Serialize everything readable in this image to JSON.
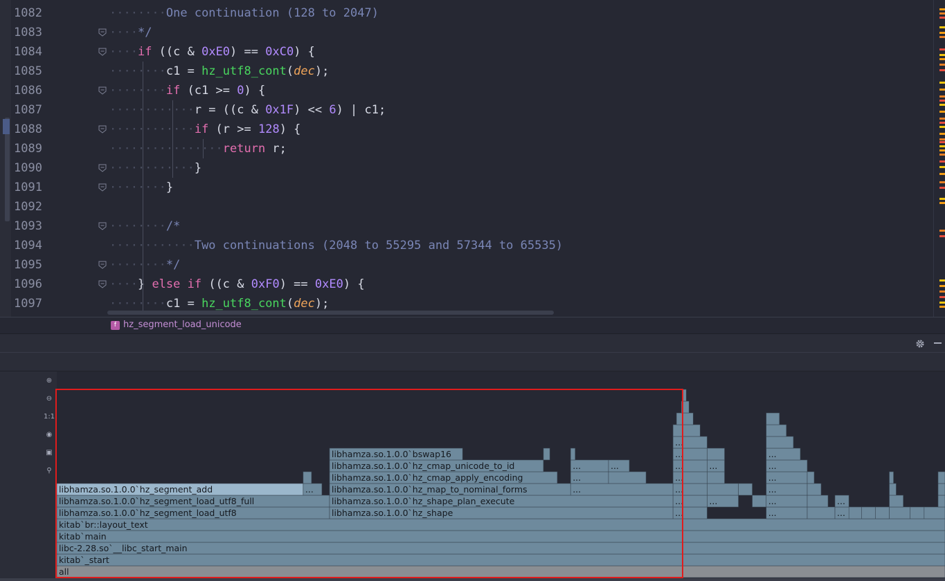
{
  "editor": {
    "lines": [
      {
        "n": "1082",
        "indent": 2,
        "segs": [
          [
            "cm",
            "One continuation (128 to 2047)"
          ]
        ]
      },
      {
        "n": "1083",
        "indent": 1,
        "segs": [
          [
            "cm",
            "*/"
          ]
        ]
      },
      {
        "n": "1084",
        "indent": 1,
        "segs": [
          [
            "kw",
            "if"
          ],
          [
            "op",
            " ((c & "
          ],
          [
            "num",
            "0xE0"
          ],
          [
            "op",
            ") == "
          ],
          [
            "num",
            "0xC0"
          ],
          [
            "op",
            ") {"
          ]
        ]
      },
      {
        "n": "1085",
        "indent": 2,
        "segs": [
          [
            "op",
            "c1 = "
          ],
          [
            "fn",
            "hz_utf8_cont"
          ],
          [
            "op",
            "("
          ],
          [
            "par",
            "dec"
          ],
          [
            "op",
            ");"
          ]
        ]
      },
      {
        "n": "1086",
        "indent": 2,
        "segs": [
          [
            "kw",
            "if"
          ],
          [
            "op",
            " (c1 >= "
          ],
          [
            "num",
            "0"
          ],
          [
            "op",
            ") {"
          ]
        ]
      },
      {
        "n": "1087",
        "indent": 3,
        "segs": [
          [
            "op",
            "r = ((c & "
          ],
          [
            "num",
            "0x1F"
          ],
          [
            "op",
            ") << "
          ],
          [
            "num",
            "6"
          ],
          [
            "op",
            ") | c1;"
          ]
        ]
      },
      {
        "n": "1088",
        "indent": 3,
        "segs": [
          [
            "kw",
            "if"
          ],
          [
            "op",
            " (r >= "
          ],
          [
            "num",
            "128"
          ],
          [
            "op",
            ") {"
          ]
        ]
      },
      {
        "n": "1089",
        "indent": 4,
        "segs": [
          [
            "kw",
            "return"
          ],
          [
            "op",
            " r;"
          ]
        ]
      },
      {
        "n": "1090",
        "indent": 3,
        "segs": [
          [
            "op",
            "}"
          ]
        ]
      },
      {
        "n": "1091",
        "indent": 2,
        "segs": [
          [
            "op",
            "}"
          ]
        ]
      },
      {
        "n": "1092",
        "indent": 0,
        "segs": []
      },
      {
        "n": "1093",
        "indent": 2,
        "segs": [
          [
            "cm",
            "/*"
          ]
        ]
      },
      {
        "n": "1094",
        "indent": 3,
        "segs": [
          [
            "cm",
            "Two continuations (2048 to 55295 and 57344 to 65535)"
          ]
        ]
      },
      {
        "n": "1095",
        "indent": 2,
        "segs": [
          [
            "cm",
            "*/"
          ]
        ]
      },
      {
        "n": "1096",
        "indent": 1,
        "segs": [
          [
            "op",
            "} "
          ],
          [
            "kw",
            "else if"
          ],
          [
            "op",
            " ((c & "
          ],
          [
            "num",
            "0xF0"
          ],
          [
            "op",
            ") == "
          ],
          [
            "num",
            "0xE0"
          ],
          [
            "op",
            ") {"
          ]
        ]
      },
      {
        "n": "1097",
        "indent": 2,
        "segs": [
          [
            "op",
            "c1 = "
          ],
          [
            "fn",
            "hz_utf8_cont"
          ],
          [
            "op",
            "("
          ],
          [
            "par",
            "dec"
          ],
          [
            "op",
            ");"
          ]
        ]
      }
    ],
    "fold_lines": [
      "1083",
      "1084",
      "1086",
      "1088",
      "1090",
      "1091",
      "1093",
      "1095",
      "1096"
    ]
  },
  "breadcrumb": {
    "badge": "f",
    "function": "hz_segment_load_unicode"
  },
  "flame_tools": [
    {
      "name": "zoom-in-icon",
      "glyph": "⊕"
    },
    {
      "name": "zoom-out-icon",
      "glyph": "⊖"
    },
    {
      "name": "actual-size-icon",
      "glyph": "1:1"
    },
    {
      "name": "eye-icon",
      "glyph": "◉"
    },
    {
      "name": "camera-icon",
      "glyph": "▣"
    },
    {
      "name": "search-icon",
      "glyph": "⚲"
    }
  ],
  "flame": {
    "colors": {
      "frame": "#6e8a9d",
      "highlight": "#9bb7cc",
      "root": "#8a8e93",
      "border": "#3a4754"
    },
    "frames": [
      {
        "label": "all",
        "start": 0.0,
        "end": 1.0,
        "depth": 0,
        "kind": "root"
      },
      {
        "label": "kitab`_start",
        "start": 0.0,
        "end": 1.0,
        "depth": 1
      },
      {
        "label": "libc-2.28.so`__libc_start_main",
        "start": 0.0,
        "end": 1.0,
        "depth": 2
      },
      {
        "label": "kitab`main",
        "start": 0.0,
        "end": 1.0,
        "depth": 3
      },
      {
        "label": "kitab`br::layout_text",
        "start": 0.0,
        "end": 1.0,
        "depth": 4
      },
      {
        "label": "libhamza.so.1.0.0`hz_segment_load_utf8",
        "start": 0.0,
        "end": 0.3071,
        "depth": 5
      },
      {
        "label": "libhamza.so.1.0.0`hz_segment_load_utf8_full",
        "start": 0.0,
        "end": 0.3071,
        "depth": 6
      },
      {
        "label": "libhamza.so.1.0.0`hz_segment_add",
        "start": 0.0,
        "end": 0.2774,
        "depth": 7,
        "kind": "highlight"
      },
      {
        "label": "...",
        "start": 0.2774,
        "end": 0.2985,
        "depth": 7
      },
      {
        "label": "",
        "start": 0.2774,
        "end": 0.2868,
        "depth": 8
      },
      {
        "label": "libhamza.so.1.0.0`hz_shape",
        "start": 0.3071,
        "end": 0.6938,
        "depth": 5
      },
      {
        "label": "libhamza.so.1.0.0`hz_shape_plan_execute",
        "start": 0.3071,
        "end": 0.6938,
        "depth": 6
      },
      {
        "label": "libhamza.so.1.0.0`hz_map_to_nominal_forms",
        "start": 0.3071,
        "end": 0.5785,
        "depth": 7
      },
      {
        "label": "...",
        "start": 0.5785,
        "end": 0.6938,
        "depth": 7
      },
      {
        "label": "libhamza.so.1.0.0`hz_cmap_apply_encoding",
        "start": 0.3071,
        "end": 0.5635,
        "depth": 8
      },
      {
        "label": "...",
        "start": 0.5785,
        "end": 0.6212,
        "depth": 8
      },
      {
        "label": "",
        "start": 0.6212,
        "end": 0.6634,
        "depth": 8
      },
      {
        "label": "libhamza.so.1.0.0`hz_cmap_unicode_to_id",
        "start": 0.3071,
        "end": 0.5479,
        "depth": 9
      },
      {
        "label": "...",
        "start": 0.5785,
        "end": 0.6212,
        "depth": 9
      },
      {
        "label": "...",
        "start": 0.6212,
        "end": 0.6446,
        "depth": 9
      },
      {
        "label": "libhamza.so.1.0.0`bswap16",
        "start": 0.3071,
        "end": 0.4569,
        "depth": 10
      },
      {
        "label": "",
        "start": 0.5479,
        "end": 0.5551,
        "depth": 10
      },
      {
        "label": "",
        "start": 0.5785,
        "end": 0.5836,
        "depth": 10
      },
      {
        "label": "...",
        "start": 0.6938,
        "end": 0.7322,
        "depth": 5
      },
      {
        "label": "...",
        "start": 0.6938,
        "end": 0.7322,
        "depth": 6
      },
      {
        "label": "...",
        "start": 0.6938,
        "end": 0.7322,
        "depth": 7
      },
      {
        "label": "...",
        "start": 0.6938,
        "end": 0.7322,
        "depth": 8
      },
      {
        "label": "...",
        "start": 0.6938,
        "end": 0.7322,
        "depth": 9
      },
      {
        "label": "...",
        "start": 0.6938,
        "end": 0.7322,
        "depth": 10
      },
      {
        "label": "...",
        "start": 0.6938,
        "end": 0.7322,
        "depth": 11
      },
      {
        "label": "",
        "start": 0.6938,
        "end": 0.7243,
        "depth": 12
      },
      {
        "label": "",
        "start": 0.6977,
        "end": 0.7165,
        "depth": 13
      },
      {
        "label": "",
        "start": 0.7032,
        "end": 0.7118,
        "depth": 14
      },
      {
        "label": "",
        "start": 0.7048,
        "end": 0.7087,
        "depth": 15
      },
      {
        "label": "...",
        "start": 0.7322,
        "end": 0.7674,
        "depth": 6
      },
      {
        "label": "",
        "start": 0.7322,
        "end": 0.7674,
        "depth": 7
      },
      {
        "label": "",
        "start": 0.7322,
        "end": 0.7518,
        "depth": 8
      },
      {
        "label": "...",
        "start": 0.7322,
        "end": 0.7518,
        "depth": 9
      },
      {
        "label": "",
        "start": 0.7322,
        "end": 0.7518,
        "depth": 10
      },
      {
        "label": "",
        "start": 0.7674,
        "end": 0.783,
        "depth": 7
      },
      {
        "label": "",
        "start": 0.783,
        "end": 0.7987,
        "depth": 6
      },
      {
        "label": "...",
        "start": 0.7987,
        "end": 0.8449,
        "depth": 5
      },
      {
        "label": "...",
        "start": 0.7987,
        "end": 0.8449,
        "depth": 6
      },
      {
        "label": "...",
        "start": 0.7987,
        "end": 0.8449,
        "depth": 7
      },
      {
        "label": "...",
        "start": 0.7987,
        "end": 0.8449,
        "depth": 8
      },
      {
        "label": "...",
        "start": 0.7987,
        "end": 0.8449,
        "depth": 9
      },
      {
        "label": "...",
        "start": 0.7987,
        "end": 0.8371,
        "depth": 10
      },
      {
        "label": "",
        "start": 0.7987,
        "end": 0.8293,
        "depth": 11
      },
      {
        "label": "",
        "start": 0.7987,
        "end": 0.8214,
        "depth": 12
      },
      {
        "label": "",
        "start": 0.7987,
        "end": 0.8136,
        "depth": 13
      },
      {
        "label": "",
        "start": 0.8449,
        "end": 0.8761,
        "depth": 5
      },
      {
        "label": "",
        "start": 0.8449,
        "end": 0.8683,
        "depth": 6
      },
      {
        "label": "",
        "start": 0.8449,
        "end": 0.8605,
        "depth": 7
      },
      {
        "label": "",
        "start": 0.8449,
        "end": 0.8527,
        "depth": 8
      },
      {
        "label": "...",
        "start": 0.8761,
        "end": 0.9373,
        "depth": 5
      },
      {
        "label": "...",
        "start": 0.8761,
        "end": 0.8918,
        "depth": 6
      },
      {
        "label": "",
        "start": 0.8918,
        "end": 0.906,
        "depth": 5
      },
      {
        "label": "",
        "start": 0.906,
        "end": 0.9216,
        "depth": 5
      },
      {
        "label": "",
        "start": 0.9216,
        "end": 0.9373,
        "depth": 5
      },
      {
        "label": "",
        "start": 0.9373,
        "end": 0.9608,
        "depth": 5
      },
      {
        "label": "",
        "start": 0.9608,
        "end": 0.9765,
        "depth": 5
      },
      {
        "label": "",
        "start": 0.9765,
        "end": 1.0,
        "depth": 5
      },
      {
        "label": "",
        "start": 0.9373,
        "end": 0.953,
        "depth": 6
      },
      {
        "label": "",
        "start": 0.9373,
        "end": 0.945,
        "depth": 7
      },
      {
        "label": "",
        "start": 0.9373,
        "end": 0.942,
        "depth": 8
      },
      {
        "label": "",
        "start": 0.9922,
        "end": 1.0,
        "depth": 6
      },
      {
        "label": "",
        "start": 0.9922,
        "end": 1.0,
        "depth": 7
      },
      {
        "label": "",
        "start": 0.9922,
        "end": 1.0,
        "depth": 8
      }
    ]
  }
}
